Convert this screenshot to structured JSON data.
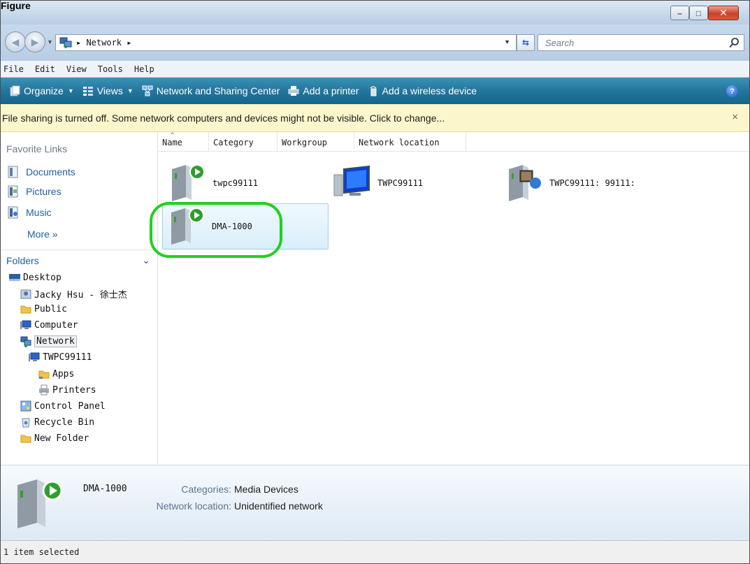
{
  "figure": {
    "label": "Figure"
  },
  "window_controls": {
    "minimize": "–",
    "maximize": "□",
    "close": "✕"
  },
  "address": {
    "path": "▸ Network ▸",
    "search_placeholder": "Search"
  },
  "menu": [
    "File",
    "Edit",
    "View",
    "Tools",
    "Help"
  ],
  "toolbar": {
    "organize": "Organize",
    "views": "Views",
    "network_center": "Network and Sharing Center",
    "add_printer": "Add a printer",
    "add_wireless": "Add a wireless device",
    "help": "?"
  },
  "infobar": {
    "message": "File sharing is turned off. Some network computers and devices might not be visible. Click to change...",
    "close": "×"
  },
  "navpane": {
    "favorites_title": "Favorite Links",
    "favorites": [
      "Documents",
      "Pictures",
      "Music"
    ],
    "more": "More »",
    "folders_title": "Folders",
    "tree": [
      "Desktop",
      "Jacky Hsu - 徐士杰",
      "Public",
      "Computer",
      "Network",
      "TWPC99111",
      "Apps",
      "Printers",
      "Control Panel",
      "Recycle Bin",
      "New Folder"
    ]
  },
  "content": {
    "columns": [
      "Name",
      "Category",
      "Workgroup",
      "Network location"
    ],
    "items": [
      "twpc99111",
      "TWPC99111",
      "TWPC99111: 99111:",
      "DMA-1000"
    ]
  },
  "details": {
    "name": "DMA-1000",
    "categories_key": "Categories:",
    "categories_val": "Media Devices",
    "location_key": "Network location:",
    "location_val": "Unidentified network"
  },
  "status": {
    "text": "1 item selected"
  },
  "colors": {
    "toolbar": "#23769c",
    "infobar": "#fbf6cc",
    "highlight": "#20d020",
    "link": "#1f5ea8"
  }
}
